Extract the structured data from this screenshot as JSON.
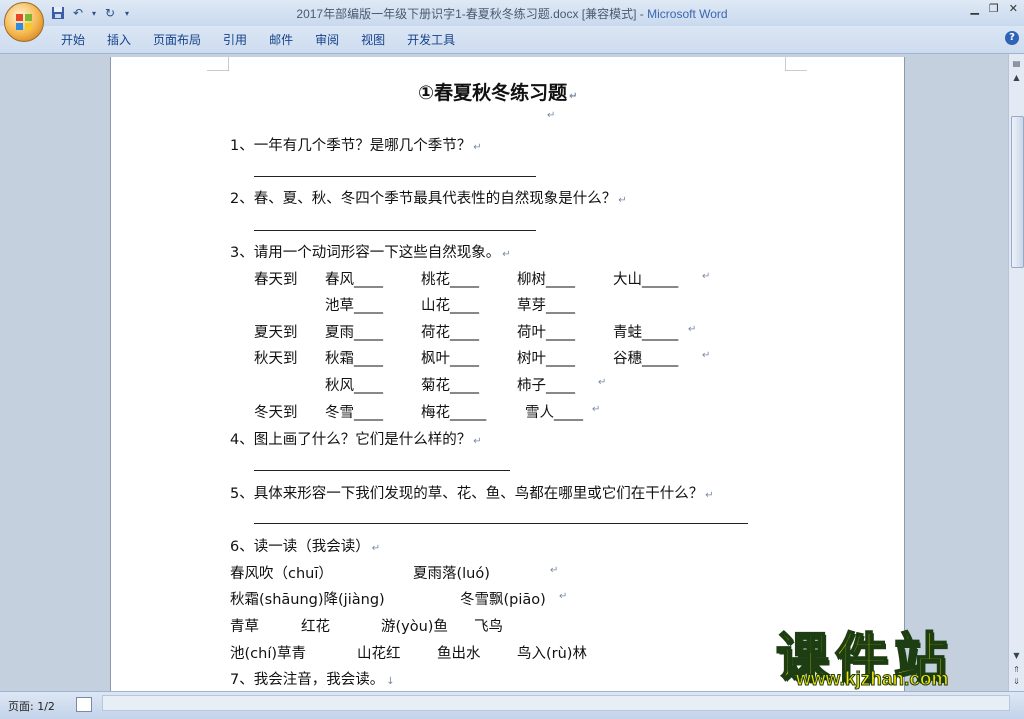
{
  "window": {
    "title_doc": "2017年部编版一年级下册识字1-春夏秋冬练习题.docx [兼容模式] - ",
    "title_app": "Microsoft Word",
    "minimize_icon": "minimize-icon",
    "restore_icon": "restore-icon",
    "close_icon": "close-icon"
  },
  "ribbon": {
    "tabs": [
      "开始",
      "插入",
      "页面布局",
      "引用",
      "邮件",
      "审阅",
      "视图",
      "开发工具"
    ]
  },
  "status": {
    "page": "页面: 1/2"
  },
  "doc": {
    "title": "①春夏秋冬练习题",
    "q1": "1、一年有几个季节？是哪几个季节？",
    "q2": "2、春、夏、秋、冬四个季节最具代表性的自然现象是什么？",
    "q3": "3、请用一个动词形容一下这些自然现象。",
    "r1": [
      "春天到",
      "春风____",
      "桃花____",
      "柳树____",
      "大山_____"
    ],
    "r2": [
      "池草____",
      "山花____",
      "草芽____"
    ],
    "r3": [
      "夏天到",
      "夏雨____",
      "荷花____",
      "荷叶____",
      "青蛙_____"
    ],
    "r4": [
      "秋天到",
      "秋霜____",
      "枫叶____",
      "树叶____",
      "谷穗_____"
    ],
    "r5": [
      "秋风____",
      "菊花____",
      "柿子____"
    ],
    "r6": [
      "冬天到",
      "冬雪____",
      "梅花_____",
      "雪人____"
    ],
    "q4": "4、图上画了什么？它们是什么样的？",
    "q5": "5、具体来形容一下我们发现的草、花、鱼、鸟都在哪里或它们在干什么？",
    "q6": "6、读一读（我会读）",
    "p1": [
      "春风吹（chuī）",
      "夏雨落(luó)"
    ],
    "p2": [
      "秋霜(shāung)降(jiàng)",
      "冬雪飘(piāo)"
    ],
    "p3": [
      "青草",
      "红花",
      "游(yòu)鱼",
      "飞鸟"
    ],
    "p4": [
      "池(chí)草青",
      "山花红",
      "鱼出水",
      "鸟入(rù)林"
    ],
    "q7": "7、我会注音，我会读。"
  },
  "watermark": {
    "logo": "课件站",
    "url": "www.kjzhan.com"
  }
}
